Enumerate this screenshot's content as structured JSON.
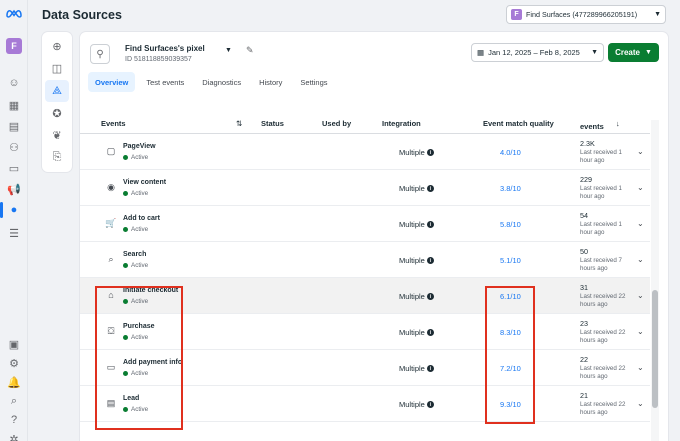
{
  "app": {
    "title": "Data Sources"
  },
  "account": {
    "initial": "F",
    "label": "Find Surfaces (477289966205191)"
  },
  "rail": {
    "avatar_initial": "F"
  },
  "pixel": {
    "name": "Find Surfaces's pixel",
    "id": "ID 518118859039357"
  },
  "date_range": "Jan 12, 2025 – Feb 8, 2025",
  "create_label": "Create",
  "tabs": [
    {
      "label": "Overview",
      "selected": true
    },
    {
      "label": "Test events"
    },
    {
      "label": "Diagnostics"
    },
    {
      "label": "History"
    },
    {
      "label": "Settings"
    }
  ],
  "columns": {
    "events": "Events",
    "status": "Status",
    "used_by": "Used by",
    "integration": "Integration",
    "emq": "Event match quality",
    "total_events": "events"
  },
  "rows": [
    {
      "icon": "window-icon",
      "name": "PageView",
      "status": "Active",
      "integration": "Multiple",
      "emq": "4.0/10",
      "count": "2.3K",
      "received": "Last received 1 hour ago"
    },
    {
      "icon": "eye-icon",
      "name": "View content",
      "status": "Active",
      "integration": "Multiple",
      "emq": "3.8/10",
      "count": "229",
      "received": "Last received 1 hour ago"
    },
    {
      "icon": "cart-icon",
      "name": "Add to cart",
      "status": "Active",
      "integration": "Multiple",
      "emq": "5.8/10",
      "count": "54",
      "received": "Last received 1 hour ago"
    },
    {
      "icon": "search-icon",
      "name": "Search",
      "status": "Active",
      "integration": "Multiple",
      "emq": "5.1/10",
      "count": "50",
      "received": "Last received 7 hours ago"
    },
    {
      "icon": "basket-icon",
      "name": "Initiate checkout",
      "status": "Active",
      "integration": "Multiple",
      "emq": "6.1/10",
      "count": "31",
      "received": "Last received 22 hours ago"
    },
    {
      "icon": "bag-icon",
      "name": "Purchase",
      "status": "Active",
      "integration": "Multiple",
      "emq": "8.3/10",
      "count": "23",
      "received": "Last received 22 hours ago"
    },
    {
      "icon": "card-icon",
      "name": "Add payment info",
      "status": "Active",
      "integration": "Multiple",
      "emq": "7.2/10",
      "count": "22",
      "received": "Last received 22 hours ago"
    },
    {
      "icon": "form-icon",
      "name": "Lead",
      "status": "Active",
      "integration": "Multiple",
      "emq": "9.3/10",
      "count": "21",
      "received": "Last received 22 hours ago"
    }
  ],
  "colors": {
    "accent": "#1877f2",
    "create": "#0a7d32",
    "highlight_box": "#e0301e"
  }
}
